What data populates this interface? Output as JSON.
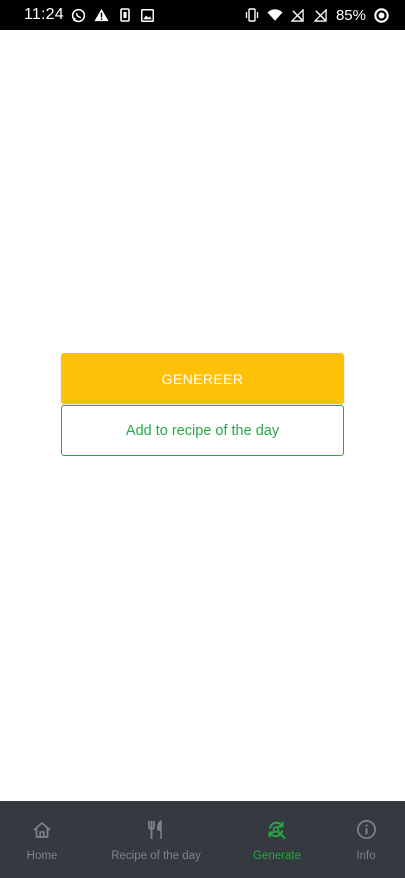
{
  "status_bar": {
    "time": "11:24",
    "battery_percent": "85%",
    "left_icons": [
      "whatsapp-icon",
      "warning-icon",
      "sim-icon",
      "image-icon"
    ],
    "right_icons": [
      "vibrate-icon",
      "wifi-icon",
      "no-signal-icon",
      "no-signal-icon",
      "battery-icon"
    ]
  },
  "main": {
    "generate_label": "GENEREER",
    "add_label": "Add to recipe of the day"
  },
  "bottom_nav": {
    "items": [
      {
        "label": "Home",
        "icon": "home-icon",
        "active": false
      },
      {
        "label": "Recipe of the day",
        "icon": "fork-knife-icon",
        "active": false
      },
      {
        "label": "Generate",
        "icon": "refresh-search-icon",
        "active": true
      },
      {
        "label": "Info",
        "icon": "info-icon",
        "active": false
      }
    ]
  },
  "colors": {
    "primary_button": "#FFC107",
    "accent_green": "#28a745",
    "nav_background": "#343a40",
    "nav_inactive": "#7c8389",
    "status_bar": "#000000"
  }
}
